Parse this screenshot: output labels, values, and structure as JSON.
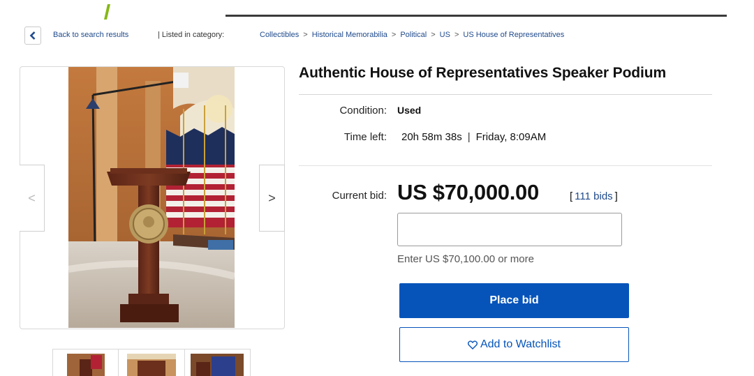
{
  "nav": {
    "back_label": "Back to search results",
    "listed_label": "| Listed in category:",
    "breadcrumbs": [
      "Collectibles",
      "Historical Memorabilia",
      "Political",
      "US",
      "US House of Representatives"
    ],
    "separator": ">"
  },
  "listing": {
    "title": "Authentic House of Representatives Speaker Podium",
    "condition_label": "Condition:",
    "condition_value": "Used",
    "time_left_label": "Time left:",
    "time_left_value": "20h 58m 38s",
    "time_separator": "|",
    "end_time": "Friday, 8:09AM"
  },
  "bidding": {
    "current_bid_label": "Current bid:",
    "current_bid_value": "US $70,000.00",
    "bid_count_open": "[",
    "bid_count_link": "111 bids",
    "bid_count_close": "]",
    "input_value": "",
    "hint": "Enter US $70,100.00 or more",
    "place_bid_label": "Place bid",
    "watchlist_label": "Add to Watchlist"
  },
  "gallery": {
    "prev_icon": "chevron-left-icon",
    "next_icon": "chevron-right-icon",
    "prev_glyph": "<",
    "next_glyph": ">",
    "thumbnail_count": 3
  },
  "colors": {
    "primary_blue": "#0654ba",
    "link_blue": "#1f4a8c"
  }
}
